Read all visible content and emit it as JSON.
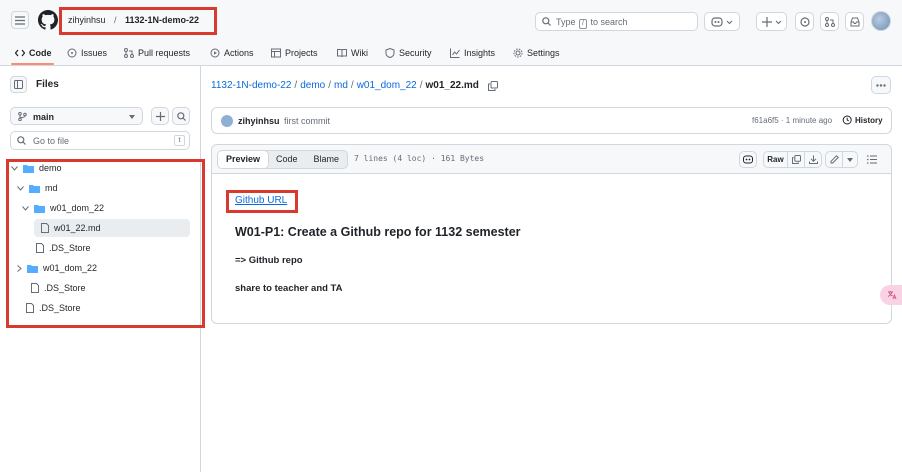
{
  "header": {
    "owner": "zihyinhsu",
    "separator": "/",
    "repo": "1132-1N-demo-22",
    "search_prefix": "Type",
    "search_key": "/",
    "search_suffix": "to search"
  },
  "nav": {
    "tabs": [
      {
        "label": "Code",
        "icon": "code-icon",
        "active": true
      },
      {
        "label": "Issues",
        "icon": "issue-icon"
      },
      {
        "label": "Pull requests",
        "icon": "pull-request-icon"
      },
      {
        "label": "Actions",
        "icon": "play-icon"
      },
      {
        "label": "Projects",
        "icon": "table-icon"
      },
      {
        "label": "Wiki",
        "icon": "book-icon"
      },
      {
        "label": "Security",
        "icon": "shield-icon"
      },
      {
        "label": "Insights",
        "icon": "graph-icon"
      },
      {
        "label": "Settings",
        "icon": "gear-icon"
      }
    ]
  },
  "sidebar": {
    "title": "Files",
    "branch": "main",
    "goto_placeholder": "Go to file",
    "goto_key": "t",
    "tree": [
      {
        "label": "demo",
        "type": "folder",
        "expanded": true
      },
      {
        "label": "md",
        "type": "folder",
        "expanded": true
      },
      {
        "label": "w01_dom_22",
        "type": "folder",
        "expanded": true
      },
      {
        "label": "w01_22.md",
        "type": "file",
        "selected": true
      },
      {
        "label": ".DS_Store",
        "type": "file"
      },
      {
        "label": "w01_dom_22",
        "type": "folder",
        "expanded": false
      },
      {
        "label": ".DS_Store",
        "type": "file"
      },
      {
        "label": ".DS_Store",
        "type": "file"
      }
    ]
  },
  "breadcrumb": {
    "parts": [
      "1132-1N-demo-22",
      "demo",
      "md",
      "w01_dom_22"
    ],
    "sep": "/",
    "current": "w01_22.md"
  },
  "commit": {
    "user": "zihyinhsu",
    "message": "first commit",
    "meta": "f61a6f5 · 1 minute ago",
    "history_label": "History"
  },
  "file": {
    "tabs": [
      "Preview",
      "Code",
      "Blame"
    ],
    "info": "7 lines (4 loc) · 161 Bytes",
    "raw_label": "Raw"
  },
  "markdown": {
    "link": "Github URL",
    "heading": "W01-P1: Create a Github repo for 1132 semester",
    "line1": "=> Github repo",
    "line2": "share to teacher and TA"
  },
  "colors": {
    "accent": "#0969da",
    "highlight_border": "#d9392e",
    "tab_underline": "#fd8c73"
  }
}
